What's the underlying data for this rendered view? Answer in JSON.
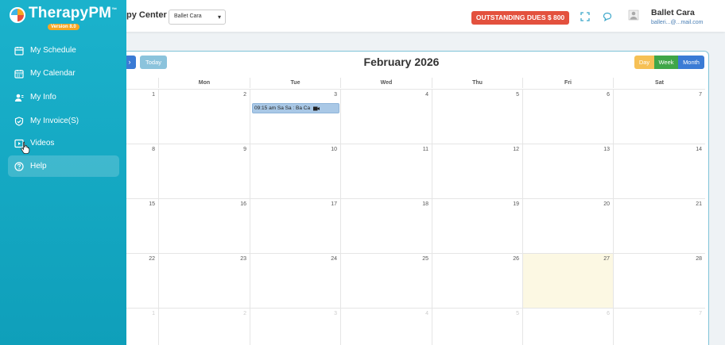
{
  "brand": {
    "name": "TherapyPM",
    "tm": "™",
    "version": "Version 8.0"
  },
  "sidebar": {
    "items": [
      {
        "label": "My Schedule",
        "icon": "schedule-icon"
      },
      {
        "label": "My Calendar",
        "icon": "calendar-icon"
      },
      {
        "label": "My Info",
        "icon": "user-info-icon"
      },
      {
        "label": "My Invoice(S)",
        "icon": "shield-icon"
      },
      {
        "label": "Videos",
        "icon": "video-icon"
      },
      {
        "label": "Help",
        "icon": "help-icon"
      }
    ]
  },
  "header": {
    "center_partial": "py Center",
    "center_select": "Ballet Cara",
    "dues_label": "OUTSTANDING DUES $ 800",
    "user_name": "Ballet Cara",
    "user_email": "balleri...@...mail.com"
  },
  "calendar": {
    "title": "February 2026",
    "today_label": "Today",
    "views": {
      "day": "Day",
      "week": "Week",
      "month": "Month"
    },
    "weekdays": [
      "",
      "Mon",
      "Tue",
      "Wed",
      "Thu",
      "Fri",
      "Sat"
    ],
    "weeks": [
      [
        "1",
        "2",
        "3",
        "4",
        "5",
        "6",
        "7"
      ],
      [
        "8",
        "9",
        "10",
        "11",
        "12",
        "13",
        "14"
      ],
      [
        "15",
        "16",
        "17",
        "18",
        "19",
        "20",
        "21"
      ],
      [
        "22",
        "23",
        "24",
        "25",
        "26",
        "27",
        "28"
      ],
      [
        "1",
        "2",
        "3",
        "4",
        "5",
        "6",
        "7"
      ]
    ],
    "event": {
      "text": "09:15 am  Sa Sa : Ba Ca"
    }
  },
  "colors": {
    "sidebar": "#13a8c3",
    "dues": "#e3513e",
    "accent": "#3a7bd5",
    "today_highlight": "#fcf8e3"
  }
}
